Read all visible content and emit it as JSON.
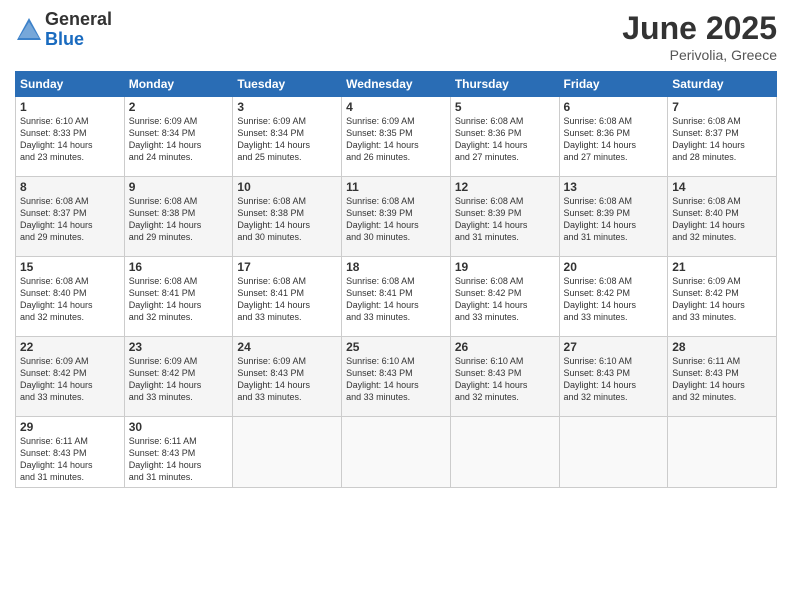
{
  "header": {
    "logo_general": "General",
    "logo_blue": "Blue",
    "month": "June 2025",
    "location": "Perivolia, Greece"
  },
  "weekdays": [
    "Sunday",
    "Monday",
    "Tuesday",
    "Wednesday",
    "Thursday",
    "Friday",
    "Saturday"
  ],
  "weeks": [
    [
      {
        "day": "1",
        "info": "Sunrise: 6:10 AM\nSunset: 8:33 PM\nDaylight: 14 hours\nand 23 minutes."
      },
      {
        "day": "2",
        "info": "Sunrise: 6:09 AM\nSunset: 8:34 PM\nDaylight: 14 hours\nand 24 minutes."
      },
      {
        "day": "3",
        "info": "Sunrise: 6:09 AM\nSunset: 8:34 PM\nDaylight: 14 hours\nand 25 minutes."
      },
      {
        "day": "4",
        "info": "Sunrise: 6:09 AM\nSunset: 8:35 PM\nDaylight: 14 hours\nand 26 minutes."
      },
      {
        "day": "5",
        "info": "Sunrise: 6:08 AM\nSunset: 8:36 PM\nDaylight: 14 hours\nand 27 minutes."
      },
      {
        "day": "6",
        "info": "Sunrise: 6:08 AM\nSunset: 8:36 PM\nDaylight: 14 hours\nand 27 minutes."
      },
      {
        "day": "7",
        "info": "Sunrise: 6:08 AM\nSunset: 8:37 PM\nDaylight: 14 hours\nand 28 minutes."
      }
    ],
    [
      {
        "day": "8",
        "info": "Sunrise: 6:08 AM\nSunset: 8:37 PM\nDaylight: 14 hours\nand 29 minutes."
      },
      {
        "day": "9",
        "info": "Sunrise: 6:08 AM\nSunset: 8:38 PM\nDaylight: 14 hours\nand 29 minutes."
      },
      {
        "day": "10",
        "info": "Sunrise: 6:08 AM\nSunset: 8:38 PM\nDaylight: 14 hours\nand 30 minutes."
      },
      {
        "day": "11",
        "info": "Sunrise: 6:08 AM\nSunset: 8:39 PM\nDaylight: 14 hours\nand 30 minutes."
      },
      {
        "day": "12",
        "info": "Sunrise: 6:08 AM\nSunset: 8:39 PM\nDaylight: 14 hours\nand 31 minutes."
      },
      {
        "day": "13",
        "info": "Sunrise: 6:08 AM\nSunset: 8:39 PM\nDaylight: 14 hours\nand 31 minutes."
      },
      {
        "day": "14",
        "info": "Sunrise: 6:08 AM\nSunset: 8:40 PM\nDaylight: 14 hours\nand 32 minutes."
      }
    ],
    [
      {
        "day": "15",
        "info": "Sunrise: 6:08 AM\nSunset: 8:40 PM\nDaylight: 14 hours\nand 32 minutes."
      },
      {
        "day": "16",
        "info": "Sunrise: 6:08 AM\nSunset: 8:41 PM\nDaylight: 14 hours\nand 32 minutes."
      },
      {
        "day": "17",
        "info": "Sunrise: 6:08 AM\nSunset: 8:41 PM\nDaylight: 14 hours\nand 33 minutes."
      },
      {
        "day": "18",
        "info": "Sunrise: 6:08 AM\nSunset: 8:41 PM\nDaylight: 14 hours\nand 33 minutes."
      },
      {
        "day": "19",
        "info": "Sunrise: 6:08 AM\nSunset: 8:42 PM\nDaylight: 14 hours\nand 33 minutes."
      },
      {
        "day": "20",
        "info": "Sunrise: 6:08 AM\nSunset: 8:42 PM\nDaylight: 14 hours\nand 33 minutes."
      },
      {
        "day": "21",
        "info": "Sunrise: 6:09 AM\nSunset: 8:42 PM\nDaylight: 14 hours\nand 33 minutes."
      }
    ],
    [
      {
        "day": "22",
        "info": "Sunrise: 6:09 AM\nSunset: 8:42 PM\nDaylight: 14 hours\nand 33 minutes."
      },
      {
        "day": "23",
        "info": "Sunrise: 6:09 AM\nSunset: 8:42 PM\nDaylight: 14 hours\nand 33 minutes."
      },
      {
        "day": "24",
        "info": "Sunrise: 6:09 AM\nSunset: 8:43 PM\nDaylight: 14 hours\nand 33 minutes."
      },
      {
        "day": "25",
        "info": "Sunrise: 6:10 AM\nSunset: 8:43 PM\nDaylight: 14 hours\nand 33 minutes."
      },
      {
        "day": "26",
        "info": "Sunrise: 6:10 AM\nSunset: 8:43 PM\nDaylight: 14 hours\nand 32 minutes."
      },
      {
        "day": "27",
        "info": "Sunrise: 6:10 AM\nSunset: 8:43 PM\nDaylight: 14 hours\nand 32 minutes."
      },
      {
        "day": "28",
        "info": "Sunrise: 6:11 AM\nSunset: 8:43 PM\nDaylight: 14 hours\nand 32 minutes."
      }
    ],
    [
      {
        "day": "29",
        "info": "Sunrise: 6:11 AM\nSunset: 8:43 PM\nDaylight: 14 hours\nand 31 minutes."
      },
      {
        "day": "30",
        "info": "Sunrise: 6:11 AM\nSunset: 8:43 PM\nDaylight: 14 hours\nand 31 minutes."
      },
      {
        "day": "",
        "info": ""
      },
      {
        "day": "",
        "info": ""
      },
      {
        "day": "",
        "info": ""
      },
      {
        "day": "",
        "info": ""
      },
      {
        "day": "",
        "info": ""
      }
    ]
  ]
}
